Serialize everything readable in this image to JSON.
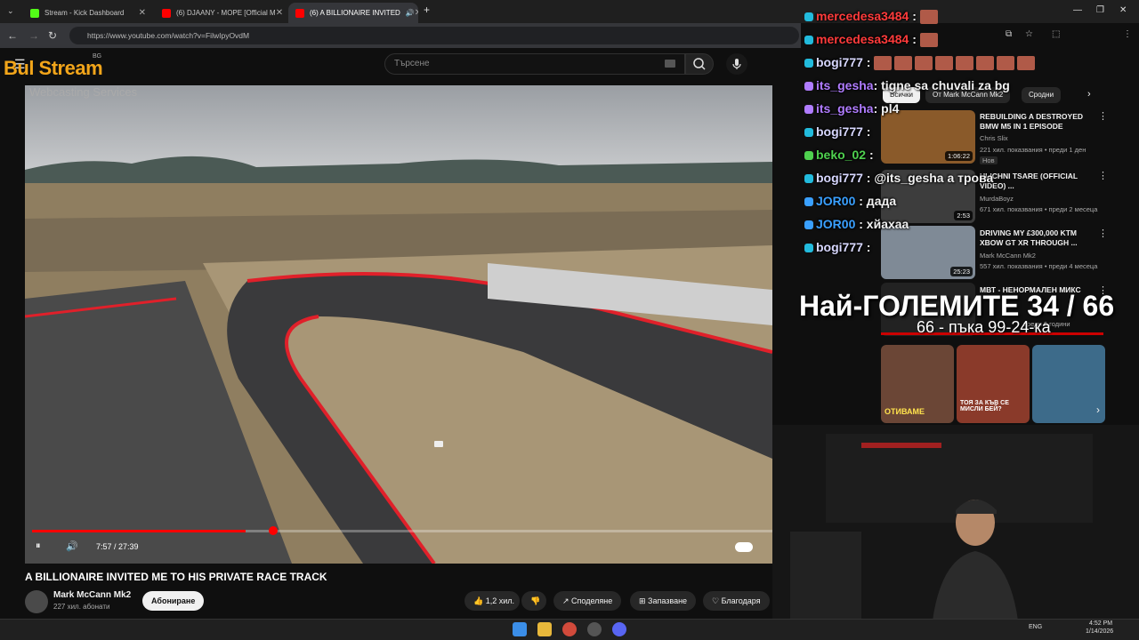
{
  "browser": {
    "tabs": [
      {
        "label": "Stream - Kick Dashboard",
        "color": "#53fc18"
      },
      {
        "label": "(6) DJAANY - MOPE [Official M",
        "color": "#ff0000"
      },
      {
        "label": "(6) A BILLIONAIRE INVITED",
        "color": "#ff0000"
      }
    ],
    "url": "https://www.youtube.com/watch?v=FilwIpyOvdM",
    "new_tab": "+"
  },
  "youtube": {
    "search_placeholder": "Търсене",
    "logo_badge": "BG",
    "video": {
      "time": "7:57 / 27:39",
      "progress": 0.288,
      "title": "A BILLIONAIRE INVITED ME TO HIS PRIVATE RACE TRACK",
      "channel": "Mark McCann Mk2",
      "subscribers": "227 хил. абонати",
      "subscribe": "Абониране",
      "likes": "1,2 хил.",
      "share": "Споделяне",
      "save": "Запазване",
      "thanks": "Благодаря"
    },
    "chips": [
      "Всички",
      "От Mark McCann Mk2",
      "Сродни"
    ],
    "recs": [
      {
        "title": "REBUILDING A DESTROYED BMW M5 IN 1 EPISODE",
        "channel": "Chris Slix",
        "meta": "221 хил. показвания • преди 1 ден",
        "badge": "Нов",
        "duration": "1:06:22"
      },
      {
        "title": "ULICHNI TSARE (OFFICIAL VIDEO) ...",
        "channel": "MurdaBoyz",
        "meta": "671 хил. показвания • преди 2 месеца",
        "duration": "2:53"
      },
      {
        "title": "DRIVING MY £300,000 KTM XBOW GT XR THROUGH ...",
        "channel": "Mark McCann Mk2",
        "meta": "557 хил. показвания • преди 4 месеца",
        "duration": "25:23"
      },
      {
        "title": "МВТ - НЕНОРМАЛЕН МИКС",
        "channel": "",
        "meta": "преди 6 години",
        "duration": ""
      }
    ],
    "shorts_labels": [
      "ОТИВАМЕ",
      "ТОЯ ЗА КЪВ СЕ МИСЛИ БЕЙ?"
    ]
  },
  "stream_overlay": {
    "logo": "Bul Stream",
    "logo_sub": "Webcasting Services",
    "counter": "Най-ГОЛЕМИТЕ 34 / 66",
    "counter_sub": "66 - пъка 99-24-ка",
    "chat": [
      {
        "user": "mercedesa3484",
        "text": ":",
        "color": "#ff3b3b"
      },
      {
        "user": "mercedesa3484",
        "text": ":",
        "color": "#ff3b3b"
      },
      {
        "user": "bogi777",
        "text": ":",
        "color": "#d8d8ff"
      },
      {
        "user": "its_gesha",
        "text": ": tigne sa chuvali za bg",
        "color": "#b07cff"
      },
      {
        "user": "its_gesha",
        "text": ": pl4",
        "color": "#b07cff"
      },
      {
        "user": "bogi777",
        "text": ":",
        "color": "#d8d8ff"
      },
      {
        "user": "beko_02",
        "text": ":",
        "color": "#4fd14f"
      },
      {
        "user": "bogi777",
        "text": ": @its_gesha а трова",
        "color": "#d8d8ff"
      },
      {
        "user": "JOR00",
        "text": ": дада",
        "color": "#3aa0ff"
      },
      {
        "user": "JOR00",
        "text": ": хйахаа",
        "color": "#3aa0ff"
      },
      {
        "user": "bogi777",
        "text": ":",
        "color": "#d8d8ff"
      }
    ]
  },
  "taskbar": {
    "lang": "ENG",
    "time": "4:52 PM",
    "date": "1/14/2026"
  }
}
